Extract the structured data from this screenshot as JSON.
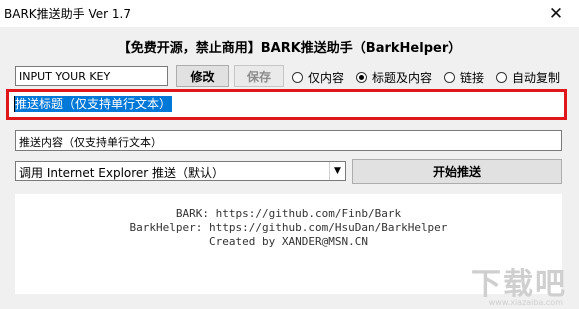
{
  "window": {
    "title": "BARK推送助手 Ver 1.7",
    "close_glyph": "✕"
  },
  "header": {
    "title": "【免费开源，禁止商用】BARK推送助手（BarkHelper）"
  },
  "key_input": {
    "value": "INPUT YOUR KEY"
  },
  "buttons": {
    "modify_label": "修改",
    "save_label": "保存",
    "push_label": "开始推送"
  },
  "radio_options": [
    {
      "label": "仅内容",
      "checked": false
    },
    {
      "label": "标题及内容",
      "checked": true
    },
    {
      "label": "链接",
      "checked": false
    },
    {
      "label": "自动复制",
      "checked": false
    }
  ],
  "title_input": {
    "value": "推送标题（仅支持单行文本）"
  },
  "content_input": {
    "value": "推送内容（仅支持单行文本）"
  },
  "browser_select": {
    "selected": "调用 Internet Explorer 推送（默认）"
  },
  "info": {
    "line1": "BARK: https://github.com/Finb/Bark",
    "line2": "BarkHelper: https://github.com/HsuDan/BarkHelper",
    "line3": "Created by XANDER@MSN.CN"
  },
  "watermark": {
    "main": "下载吧",
    "sub": "www.xiazaiba.com"
  },
  "colors": {
    "highlight": "#e0171a",
    "selection": "#0078d7"
  }
}
